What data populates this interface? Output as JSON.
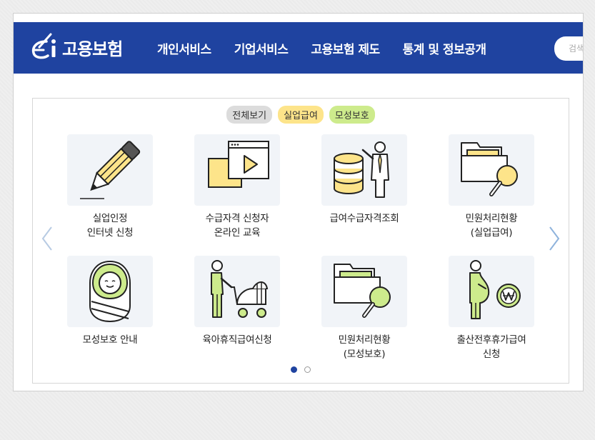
{
  "header": {
    "logo_text": "고용보험",
    "nav": [
      "개인서비스",
      "기업서비스",
      "고용보험 제도",
      "통계 및 정보공개"
    ],
    "search_placeholder": "검색"
  },
  "filters": [
    "전체보기",
    "실업급여",
    "모성보호"
  ],
  "tiles": [
    {
      "line1": "실업인정",
      "line2": "인터넷 신청",
      "icon": "pencil-icon"
    },
    {
      "line1": "수급자격 신청자",
      "line2": "온라인 교육",
      "icon": "video-play-icon"
    },
    {
      "line1": "급여수급자격조회",
      "line2": "",
      "icon": "database-presenter-icon"
    },
    {
      "line1": "민원처리현황",
      "line2": "(실업급여)",
      "icon": "folder-search-icon"
    },
    {
      "line1": "모성보호 안내",
      "line2": "",
      "icon": "baby-icon"
    },
    {
      "line1": "육아휴직급여신청",
      "line2": "",
      "icon": "stroller-icon"
    },
    {
      "line1": "민원처리현황",
      "line2": "(모성보호)",
      "icon": "folder-search-icon"
    },
    {
      "line1": "출산전후휴가급여",
      "line2": "신청",
      "icon": "pregnant-won-icon"
    }
  ],
  "colors": {
    "brand_blue": "#1f43a0",
    "yellow": "#fde48a",
    "green": "#cdeb8c"
  }
}
